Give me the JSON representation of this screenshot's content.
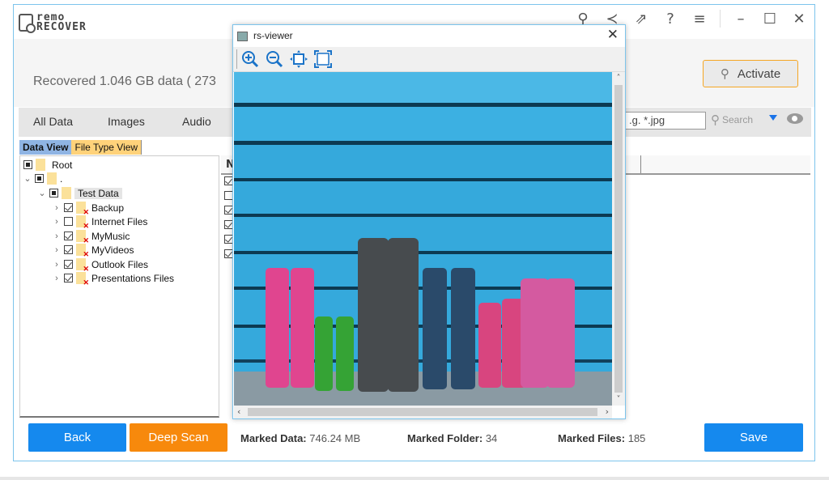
{
  "app": {
    "logo_top": "remo",
    "logo_bottom": "RECOVER",
    "title_icons": [
      "key-icon",
      "share-icon",
      "export-icon",
      "help-icon",
      "menu-icon",
      "minimize-icon",
      "maximize-icon",
      "close-icon"
    ]
  },
  "header": {
    "recovered_text": "Recovered 1.046   GB data ( 273",
    "activate_label": "Activate"
  },
  "tabs": [
    "All Data",
    "Images",
    "Audio"
  ],
  "filter": {
    "value": ".g. *.jpg",
    "search_label": "Search"
  },
  "view_tabs": {
    "active": "Data View",
    "other": "File Type View"
  },
  "tree": {
    "root": "Root",
    "dot": ".",
    "test_data": "Test Data",
    "children": [
      {
        "label": "Backup",
        "checked": true
      },
      {
        "label": "Internet Files",
        "checked": false
      },
      {
        "label": "MyMusic",
        "checked": true
      },
      {
        "label": "MyVideos",
        "checked": true
      },
      {
        "label": "Outlook Files",
        "checked": true
      },
      {
        "label": "Presentations Files",
        "checked": true
      }
    ]
  },
  "list": {
    "header_initial": "N",
    "rows_checked": [
      true,
      false,
      true,
      true,
      true,
      true
    ]
  },
  "viewer": {
    "title": "rs-viewer",
    "tools": [
      "zoom-in-icon",
      "zoom-out-icon",
      "fit-icon",
      "fullscreen-icon"
    ]
  },
  "footer": {
    "back_label": "Back",
    "deep_scan_label": "Deep Scan",
    "marked_data_label": "Marked Data:",
    "marked_data_value": "746.24 MB",
    "marked_folder_label": "Marked Folder:",
    "marked_folder_value": "34",
    "marked_files_label": "Marked Files:",
    "marked_files_value": "185",
    "save_label": "Save"
  },
  "colors": {
    "accent_blue": "#1589ee",
    "accent_orange": "#f7890c",
    "border_blue": "#7cc4ec"
  }
}
